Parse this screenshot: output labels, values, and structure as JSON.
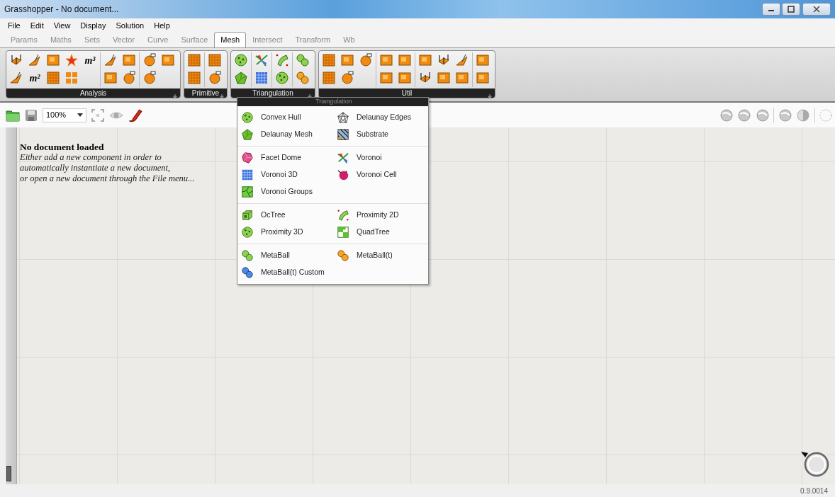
{
  "window": {
    "title": "Grasshopper - No document..."
  },
  "menu": [
    {
      "label": "File"
    },
    {
      "label": "Edit"
    },
    {
      "label": "View"
    },
    {
      "label": "Display"
    },
    {
      "label": "Solution"
    },
    {
      "label": "Help"
    }
  ],
  "tabs": [
    {
      "label": "Params",
      "selected": false
    },
    {
      "label": "Maths",
      "selected": false
    },
    {
      "label": "Sets",
      "selected": false
    },
    {
      "label": "Vector",
      "selected": false
    },
    {
      "label": "Curve",
      "selected": false
    },
    {
      "label": "Surface",
      "selected": false
    },
    {
      "label": "Mesh",
      "selected": true
    },
    {
      "label": "Intersect",
      "selected": false
    },
    {
      "label": "Transform",
      "selected": false
    },
    {
      "label": "Wb",
      "selected": false
    }
  ],
  "ribbon": [
    {
      "label": "Analysis",
      "text_icons": [
        "m³",
        "m²"
      ]
    },
    {
      "label": "Primitive"
    },
    {
      "label": "Triangulation"
    },
    {
      "label": "Util"
    }
  ],
  "canvas_toolbar": {
    "zoom": "100%"
  },
  "canvas": {
    "message_title": "No document loaded",
    "message_lines": [
      "Either add a new component in order to",
      "automatically instantiate a new document,",
      "or open a new document through the File menu..."
    ]
  },
  "dropdown": {
    "header": "Triangulation",
    "sections": [
      [
        {
          "label": "Convex Hull"
        },
        {
          "label": "Delaunay Edges"
        },
        {
          "label": "Delaunay Mesh"
        },
        {
          "label": "Substrate"
        }
      ],
      [
        {
          "label": "Facet Dome"
        },
        {
          "label": "Voronoi"
        },
        {
          "label": "Voronoi 3D"
        },
        {
          "label": "Voronoi Cell"
        },
        {
          "label": "Voronoi Groups"
        }
      ],
      [
        {
          "label": "OcTree"
        },
        {
          "label": "Proximity 2D"
        },
        {
          "label": "Proximity 3D"
        },
        {
          "label": "QuadTree"
        }
      ],
      [
        {
          "label": "MetaBall"
        },
        {
          "label": "MetaBall(t)"
        },
        {
          "label": "MetaBall(t) Custom"
        }
      ]
    ]
  },
  "status_bar": {
    "version": "0.9.0014"
  }
}
